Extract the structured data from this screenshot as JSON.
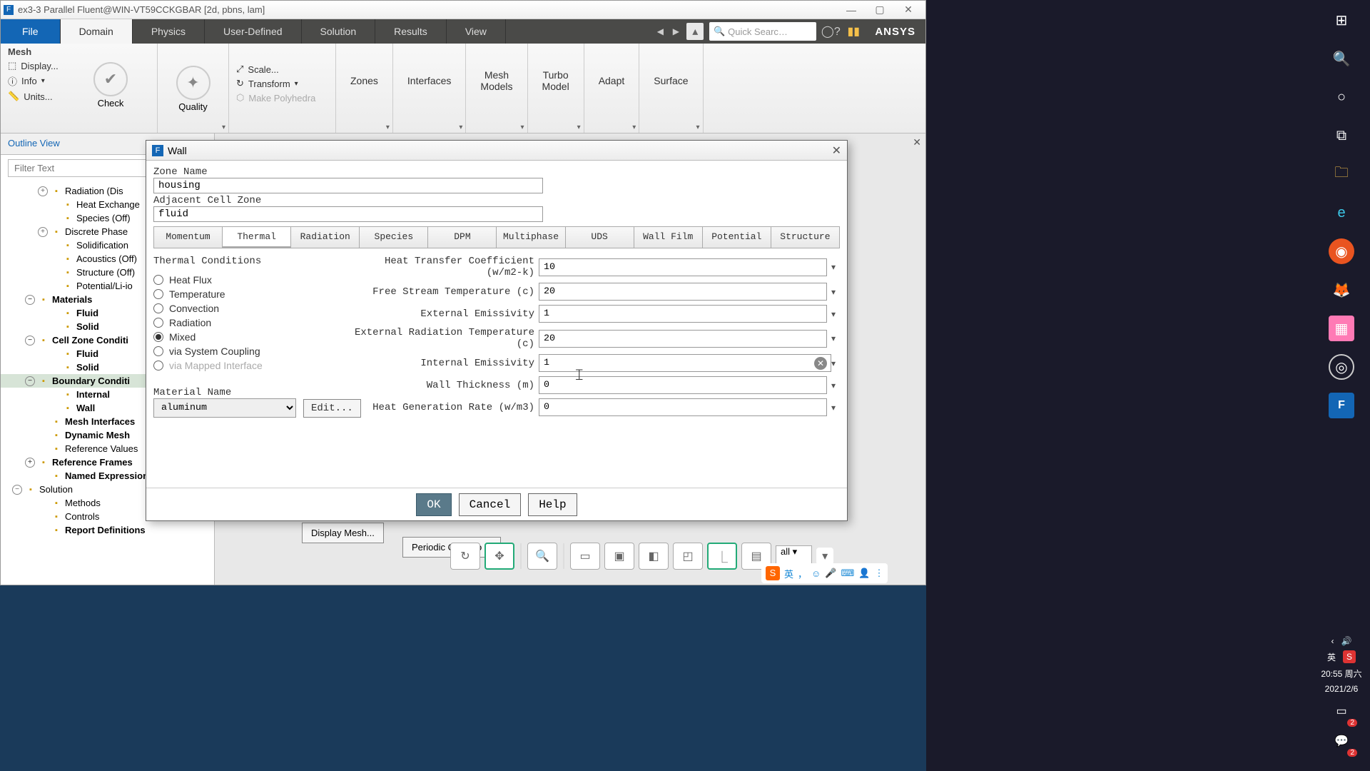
{
  "window": {
    "title": "ex3-3 Parallel Fluent@WIN-VT59CCKGBAR  [2d, pbns, lam]"
  },
  "menu": {
    "file": "File",
    "items": [
      "Domain",
      "Physics",
      "User-Defined",
      "Solution",
      "Results",
      "View"
    ],
    "active": "Domain",
    "search_placeholder": "Quick Searc…",
    "brand": "ANSYS"
  },
  "ribbon": {
    "mesh": {
      "label": "Mesh",
      "display": "Display...",
      "info": "Info",
      "units": "Units...",
      "check": "Check",
      "quality": "Quality",
      "scale": "Scale...",
      "transform": "Transform",
      "make_poly": "Make Polyhedra"
    },
    "zones": "Zones",
    "interfaces": "Interfaces",
    "mesh_models": "Mesh\nModels",
    "turbo": "Turbo\nModel",
    "adapt": "Adapt",
    "surface": "Surface"
  },
  "outline": {
    "header": "Outline View",
    "filter": "Filter Text",
    "items": [
      {
        "pad": 42,
        "text": "Radiation (Dis",
        "exp": "+",
        "bold": false
      },
      {
        "pad": 58,
        "text": "Heat Exchange",
        "bold": false
      },
      {
        "pad": 58,
        "text": "Species (Off)",
        "bold": false
      },
      {
        "pad": 42,
        "text": "Discrete Phase",
        "exp": "+",
        "bold": false
      },
      {
        "pad": 58,
        "text": "Solidification",
        "bold": false
      },
      {
        "pad": 58,
        "text": "Acoustics (Off)",
        "bold": false
      },
      {
        "pad": 58,
        "text": "Structure (Off)",
        "bold": false
      },
      {
        "pad": 58,
        "text": "Potential/Li-io",
        "bold": false
      },
      {
        "pad": 24,
        "text": "Materials",
        "exp": "-",
        "bold": true
      },
      {
        "pad": 58,
        "text": "Fluid",
        "bold": true
      },
      {
        "pad": 58,
        "text": "Solid",
        "bold": true
      },
      {
        "pad": 24,
        "text": "Cell Zone Conditi",
        "exp": "-",
        "bold": true
      },
      {
        "pad": 58,
        "text": "Fluid",
        "bold": true
      },
      {
        "pad": 58,
        "text": "Solid",
        "bold": true
      },
      {
        "pad": 24,
        "text": "Boundary Conditi",
        "exp": "-",
        "bold": true,
        "sel": true
      },
      {
        "pad": 58,
        "text": "Internal",
        "bold": true
      },
      {
        "pad": 58,
        "text": "Wall",
        "bold": true
      },
      {
        "pad": 42,
        "text": "Mesh Interfaces",
        "bold": true
      },
      {
        "pad": 42,
        "text": "Dynamic Mesh",
        "bold": true
      },
      {
        "pad": 42,
        "text": "Reference Values",
        "bold": false
      },
      {
        "pad": 24,
        "text": "Reference Frames",
        "exp": "+",
        "bold": true
      },
      {
        "pad": 42,
        "text": "Named Expressions",
        "bold": true
      },
      {
        "pad": 6,
        "text": "Solution",
        "exp": "-",
        "bold": false
      },
      {
        "pad": 42,
        "text": "Methods",
        "bold": false
      },
      {
        "pad": 42,
        "text": "Controls",
        "bold": false
      },
      {
        "pad": 42,
        "text": "Report Definitions",
        "bold": true
      }
    ]
  },
  "task_bg": {
    "display_mesh": "Display Mesh...",
    "periodic": "Periodic Conditio"
  },
  "dialog": {
    "title": "Wall",
    "zone_name_label": "Zone Name",
    "zone_name": "housing",
    "adj_label": "Adjacent Cell Zone",
    "adj_value": "fluid",
    "tabs": [
      "Momentum",
      "Thermal",
      "Radiation",
      "Species",
      "DPM",
      "Multiphase",
      "UDS",
      "Wall Film",
      "Potential",
      "Structure"
    ],
    "active_tab": "Thermal",
    "thermal_conditions_label": "Thermal Conditions",
    "radios": [
      {
        "label": "Heat Flux",
        "checked": false
      },
      {
        "label": "Temperature",
        "checked": false
      },
      {
        "label": "Convection",
        "checked": false
      },
      {
        "label": "Radiation",
        "checked": false
      },
      {
        "label": "Mixed",
        "checked": true
      },
      {
        "label": "via System Coupling",
        "checked": false
      },
      {
        "label": "via Mapped Interface",
        "checked": false,
        "disabled": true
      }
    ],
    "fields": [
      {
        "label": "Heat Transfer Coefficient (w/m2-k)",
        "value": "10"
      },
      {
        "label": "Free Stream Temperature (c)",
        "value": "20"
      },
      {
        "label": "External Emissivity",
        "value": "1"
      },
      {
        "label": "External Radiation Temperature (c)",
        "value": "20"
      },
      {
        "label": "Internal Emissivity",
        "value": "1",
        "clear": true
      },
      {
        "label": "Wall Thickness (m)",
        "value": "0"
      },
      {
        "label": "Heat Generation Rate (w/m3)",
        "value": "0"
      }
    ],
    "material_label": "Material Name",
    "material_value": "aluminum",
    "edit": "Edit...",
    "ok": "OK",
    "cancel": "Cancel",
    "help": "Help"
  },
  "graphics_toolbar": {
    "dropdown": "all"
  },
  "ime": {
    "lang": "英"
  },
  "clock": {
    "time": "20:55 周六",
    "date": "2021/2/6"
  },
  "tray_lang": "英"
}
